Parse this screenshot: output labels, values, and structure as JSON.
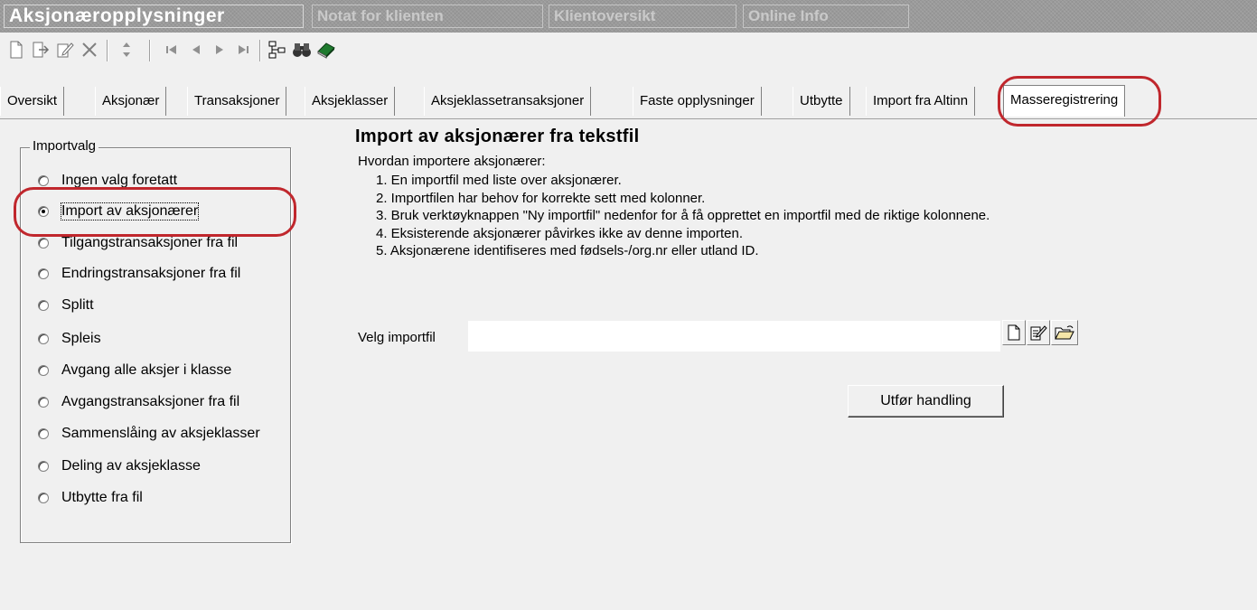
{
  "window": {
    "tabs": [
      {
        "label": "Aksjonæropplysninger"
      },
      {
        "label": "Notat for klienten"
      },
      {
        "label": "Klientoversikt"
      },
      {
        "label": "Online Info"
      }
    ]
  },
  "toolbar": {
    "buttons": [
      "new-document-icon",
      "export-icon",
      "edit-icon",
      "delete-icon",
      "sort-icon",
      "first-record-icon",
      "previous-record-icon",
      "next-record-icon",
      "last-record-icon",
      "hierarchy-icon",
      "binoculars-icon",
      "book-icon"
    ]
  },
  "tabs": [
    {
      "label": "Oversikt"
    },
    {
      "label": "Aksjonær"
    },
    {
      "label": "Transaksjoner"
    },
    {
      "label": "Aksjeklasser"
    },
    {
      "label": "Aksjeklassetransaksjoner"
    },
    {
      "label": "Faste opplysninger"
    },
    {
      "label": "Utbytte"
    },
    {
      "label": "Import fra Altinn"
    },
    {
      "label": "Masseregistrering"
    }
  ],
  "selected_tab": "Masseregistrering",
  "import_options": {
    "legend": "Importvalg",
    "selected": "Import av aksjonærer",
    "options": [
      {
        "label": "Ingen valg foretatt"
      },
      {
        "label": "Import av aksjonærer"
      },
      {
        "label": "Tilgangstransaksjoner fra fil"
      },
      {
        "label": "Endringstransaksjoner fra fil"
      },
      {
        "label": "Splitt"
      },
      {
        "label": "Spleis"
      },
      {
        "label": "Avgang alle aksjer i klasse"
      },
      {
        "label": "Avgangstransaksjoner fra fil"
      },
      {
        "label": "Sammenslåing av aksjeklasser"
      },
      {
        "label": "Deling av aksjeklasse"
      },
      {
        "label": "Utbytte fra fil"
      }
    ]
  },
  "main": {
    "heading": "Import av aksjonærer fra tekstfil",
    "intro": "Hvordan importere aksjonærer:",
    "steps": [
      "1. En importfil med liste over aksjonærer.",
      "2. Importfilen har behov for korrekte sett med kolonner.",
      "3. Bruk verktøyknappen \"Ny importfil\" nedenfor for å få opprettet en importfil med de riktige kolonnene.",
      "4. Eksisterende aksjonærer påvirkes ikke av denne importen.",
      "5. Aksjonærene identifiseres med fødsels-/org.nr eller utland ID."
    ],
    "file_label": "Velg importfil",
    "file_value": "",
    "file_buttons": [
      "new-file-icon",
      "edit-file-icon",
      "open-folder-icon"
    ],
    "action_button": "Utfør handling"
  },
  "highlight_color": "#c0272d"
}
